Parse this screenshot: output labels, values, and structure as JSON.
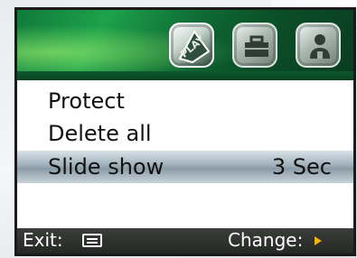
{
  "header": {
    "tabs": [
      {
        "name": "play",
        "icon": "play-mode-icon",
        "label": "PLAY",
        "active": true
      },
      {
        "name": "setup",
        "icon": "toolbox-icon",
        "active": false
      },
      {
        "name": "user",
        "icon": "person-icon",
        "active": false
      }
    ],
    "accent_color": "#1da24a"
  },
  "menu": {
    "items": [
      {
        "label": "Protect",
        "value": ""
      },
      {
        "label": "Delete all",
        "value": ""
      },
      {
        "label": "Slide show",
        "value": "3 Sec",
        "selected": true
      }
    ]
  },
  "footer": {
    "exit_label": "Exit:",
    "exit_icon": "menu-button-icon",
    "change_label": "Change:",
    "change_icon": "right-arrow-icon",
    "arrow_color": "#f2b400"
  }
}
